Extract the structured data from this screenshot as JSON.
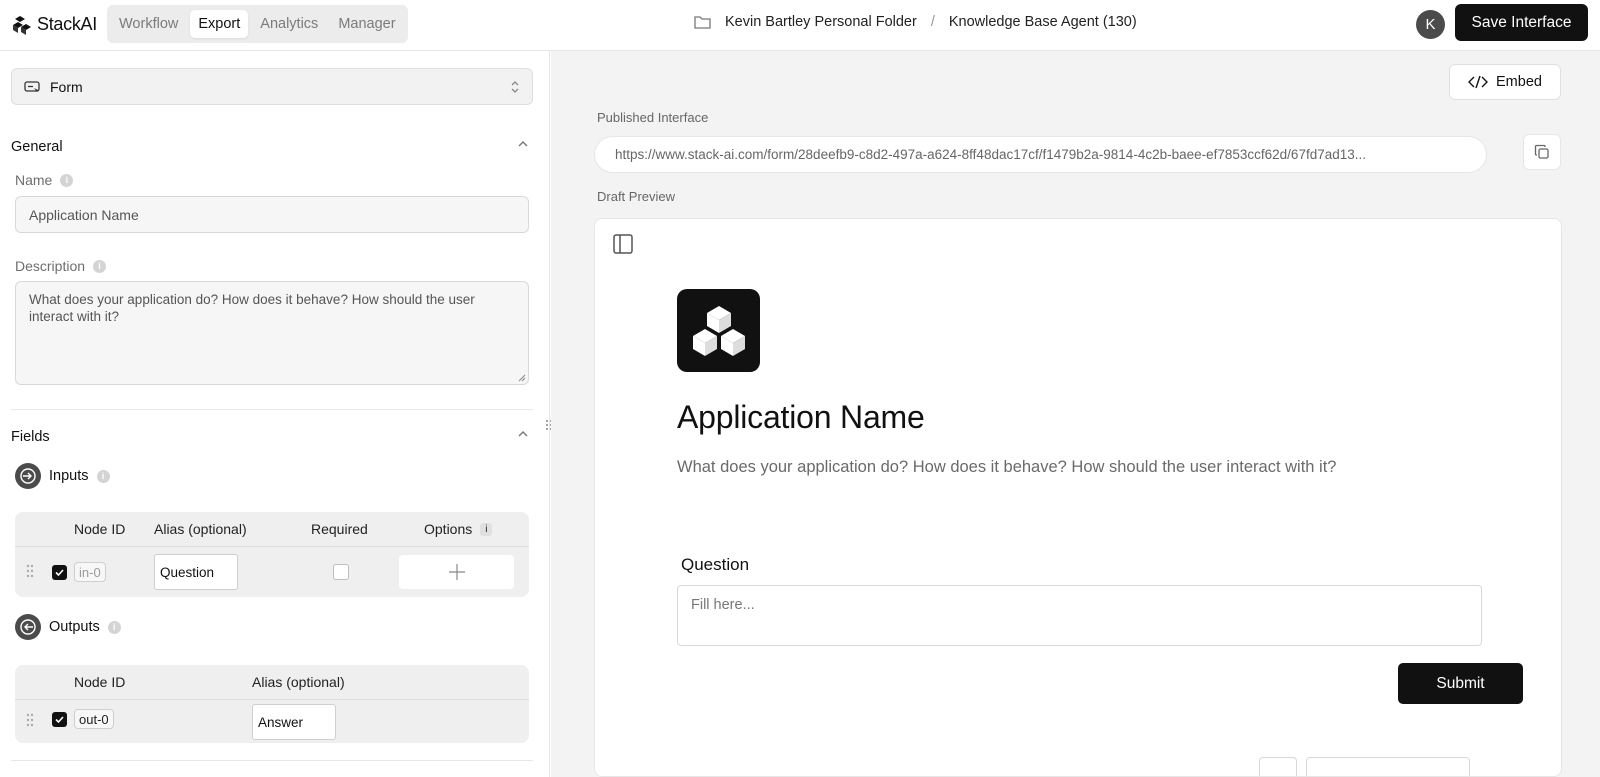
{
  "app": {
    "logo_text": "StackAI"
  },
  "header": {
    "tabs": [
      {
        "label": "Workflow",
        "active": false
      },
      {
        "label": "Export",
        "active": true
      },
      {
        "label": "Analytics",
        "active": false
      },
      {
        "label": "Manager",
        "active": false
      }
    ],
    "breadcrumb": {
      "folder": "Kevin Bartley Personal Folder",
      "separator": "/",
      "project": "Knowledge Base Agent (130)"
    },
    "avatar_initial": "K",
    "save_label": "Save Interface"
  },
  "left": {
    "interface_type": "Form",
    "general": {
      "title": "General",
      "name_label": "Name",
      "name_value": "Application Name",
      "description_label": "Description",
      "description_value": "What does your application do? How does it behave? How should the user interact with it?"
    },
    "fields": {
      "title": "Fields",
      "inputs": {
        "title": "Inputs",
        "headers": {
          "node_id": "Node ID",
          "alias": "Alias (optional)",
          "required": "Required",
          "options": "Options",
          "options_info": "i"
        },
        "rows": [
          {
            "node_id": "in-0",
            "alias": "Question",
            "enabled": true,
            "required": false
          }
        ]
      },
      "outputs": {
        "title": "Outputs",
        "headers": {
          "node_id": "Node ID",
          "alias": "Alias (optional)"
        },
        "rows": [
          {
            "node_id": "out-0",
            "alias": "Answer",
            "enabled": true
          }
        ]
      }
    }
  },
  "right": {
    "embed_label": "Embed",
    "published_label": "Published Interface",
    "published_url": "https://www.stack-ai.com/form/28deefb9-c8d2-497a-a624-8ff48dac17cf/f1479b2a-9814-4c2b-baee-ef7853ccf62d/67fd7ad13...",
    "draft_label": "Draft Preview",
    "preview": {
      "title": "Application Name",
      "description": "What does your application do? How does it behave? How should the user interact with it?",
      "question_label": "Question",
      "question_placeholder": "Fill here...",
      "submit_label": "Submit"
    }
  },
  "colors": {
    "primary": "#111111",
    "panel_bg": "#f3f3f4",
    "icon_grey": "#4b4b4b"
  },
  "icons": [
    "stackai-logo-icon",
    "folder-icon",
    "form-icon",
    "updown-chevron-icon",
    "chevron-up-icon",
    "info-icon",
    "input-arrow-icon",
    "output-arrow-icon",
    "drag-handle-icon",
    "checkbox-icon",
    "plus-icon",
    "code-icon",
    "copy-icon",
    "sidebar-toggle-icon",
    "cubes-logo-icon",
    "resize-grip-icon"
  ]
}
